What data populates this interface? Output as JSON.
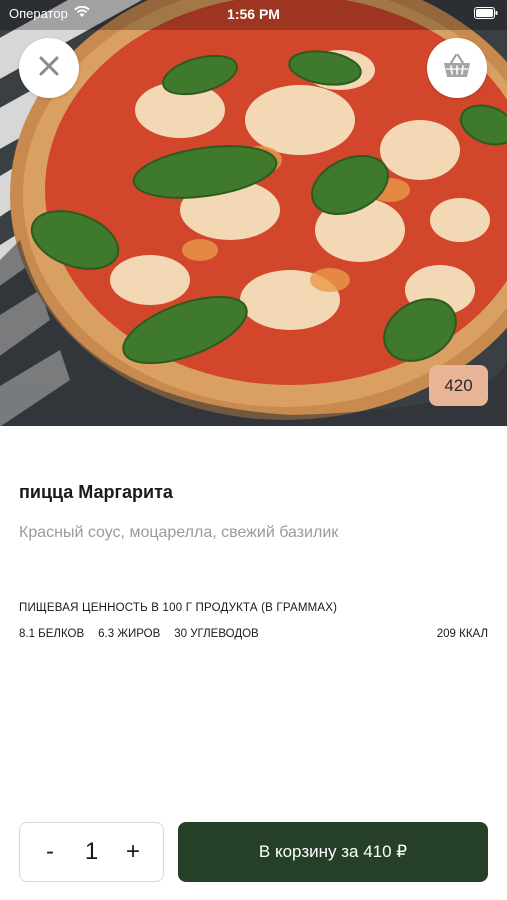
{
  "status_bar": {
    "carrier": "Оператор",
    "time": "1:56 PM"
  },
  "header": {
    "close_icon": "close-icon",
    "basket_icon": "basket-icon",
    "weight_badge": "420"
  },
  "product": {
    "title": "пицца Маргарита",
    "description": "Красный соус, моцарелла, свежий базилик"
  },
  "nutrition": {
    "heading": "ПИЩЕВАЯ ЦЕННОСТЬ В 100 Г ПРОДУКТА (В ГРАММАХ)",
    "protein": "8.1 БЕЛКОВ",
    "fat": "6.3 ЖИРОВ",
    "carbs": "30 УГЛЕВОДОВ",
    "calories": "209 ККАЛ"
  },
  "order": {
    "minus_label": "-",
    "quantity": "1",
    "plus_label": "+",
    "add_button_label": "В корзину за 410 ₽"
  },
  "colors": {
    "primary_button": "#264027",
    "weight_badge": "#e8b596",
    "description_text": "#9a9a9a"
  }
}
